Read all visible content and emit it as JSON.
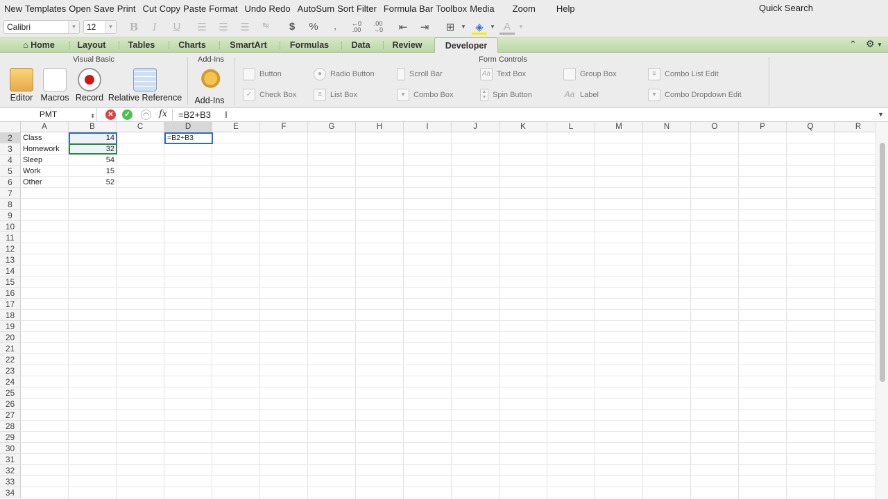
{
  "menu": [
    "New",
    "Templates",
    "Open",
    "Save",
    "Print",
    "Cut",
    "Copy",
    "Paste",
    "Format",
    "Undo",
    "Redo",
    "AutoSum",
    "Sort",
    "Filter",
    "Formula Bar",
    "Toolbox",
    "Media",
    "Zoom",
    "Help"
  ],
  "quick_search": "Quick Search",
  "format_bar": {
    "font": "Calibri",
    "size": "12"
  },
  "tabs": [
    "Home",
    "Layout",
    "Tables",
    "Charts",
    "SmartArt",
    "Formulas",
    "Data",
    "Review",
    "Developer"
  ],
  "selected_tab": "Developer",
  "ribbon": {
    "visual_basic": {
      "title": "Visual Basic",
      "editor": "Editor",
      "macros": "Macros",
      "record": "Record",
      "relative": "Relative Reference"
    },
    "addins": {
      "title": "Add-Ins",
      "label": "Add-Ins"
    },
    "form_controls": {
      "title": "Form Controls",
      "items": [
        "Button",
        "Radio Button",
        "Scroll Bar",
        "Text Box",
        "Group Box",
        "Combo List Edit",
        "Check Box",
        "List Box",
        "Combo Box",
        "Spin Button",
        "Label",
        "Combo Dropdown Edit"
      ]
    }
  },
  "formula_bar": {
    "name_box": "PMT",
    "formula": "=B2+B3"
  },
  "columns": [
    "A",
    "B",
    "C",
    "D",
    "E",
    "F",
    "G",
    "H",
    "I",
    "J",
    "K",
    "L",
    "M",
    "N",
    "O",
    "P",
    "Q",
    "R"
  ],
  "rows": [
    "2",
    "3",
    "4",
    "5",
    "6",
    "7",
    "8",
    "9",
    "10",
    "11",
    "12",
    "13",
    "14",
    "15",
    "16",
    "17",
    "18",
    "19",
    "20",
    "21",
    "22",
    "23",
    "24",
    "25",
    "26",
    "27",
    "28",
    "29",
    "30",
    "31",
    "32",
    "33",
    "34"
  ],
  "data": [
    {
      "label": "Class",
      "value": "14"
    },
    {
      "label": "Homework",
      "value": "32"
    },
    {
      "label": "Sleep",
      "value": "54"
    },
    {
      "label": "Work",
      "value": "15"
    },
    {
      "label": "Other",
      "value": "52"
    }
  ],
  "editing_cell": "=B2+B3",
  "colors": {
    "selection": "#2b6acb",
    "ref2": "#2c8a3a",
    "tabbar": "#c8e0b4"
  }
}
